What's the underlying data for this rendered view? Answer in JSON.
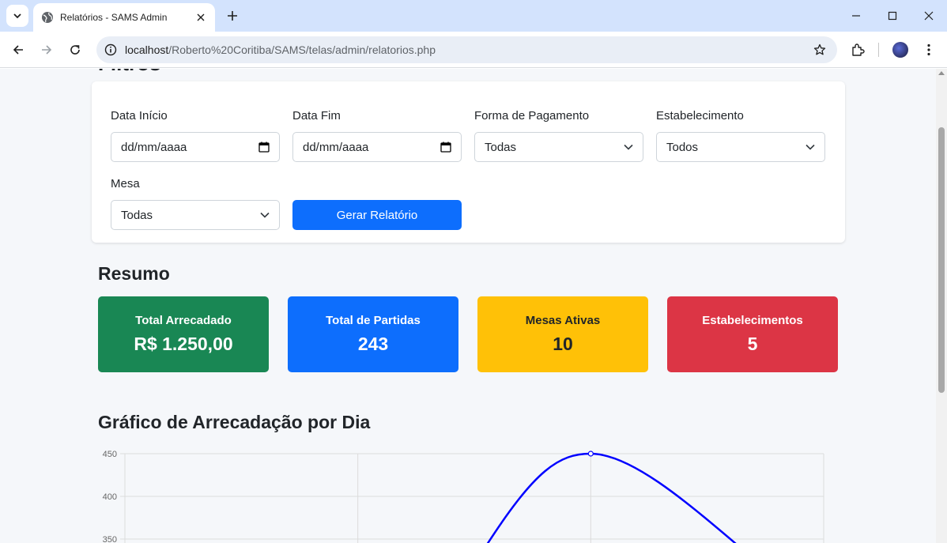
{
  "browser": {
    "tab_title": "Relatórios - SAMS Admin",
    "url_host": "localhost",
    "url_path": "/Roberto%20Coritiba/SAMS/telas/admin/relatorios.php"
  },
  "page": {
    "filters_heading": "Filtros",
    "filters": {
      "data_inicio_label": "Data Início",
      "data_inicio_value": "dd/mm/aaaa",
      "data_fim_label": "Data Fim",
      "data_fim_value": "dd/mm/aaaa",
      "forma_pagamento_label": "Forma de Pagamento",
      "forma_pagamento_value": "Todas",
      "estabelecimento_label": "Estabelecimento",
      "estabelecimento_value": "Todos",
      "mesa_label": "Mesa",
      "mesa_value": "Todas",
      "generate_button": "Gerar Relatório"
    },
    "summary_heading": "Resumo",
    "summary": [
      {
        "label": "Total Arrecadado",
        "value": "R$ 1.250,00",
        "bg": "#198754",
        "fg": "#ffffff"
      },
      {
        "label": "Total de Partidas",
        "value": "243",
        "bg": "#0d6efd",
        "fg": "#ffffff"
      },
      {
        "label": "Mesas Ativas",
        "value": "10",
        "bg": "#ffc107",
        "fg": "#212529"
      },
      {
        "label": "Estabelecimentos",
        "value": "5",
        "bg": "#dc3545",
        "fg": "#ffffff"
      }
    ],
    "chart_heading": "Gráfico de Arrecadação por Dia"
  },
  "chart_data": {
    "type": "line",
    "title": "",
    "xlabel": "",
    "ylabel": "",
    "y_ticks": [
      450,
      400,
      350
    ],
    "ylim_visible": [
      350,
      450
    ],
    "series_color": "#0000ff",
    "x_gridlines": 3,
    "visible_points": [
      {
        "x_index": 2,
        "y": 450
      }
    ],
    "grid": true
  }
}
